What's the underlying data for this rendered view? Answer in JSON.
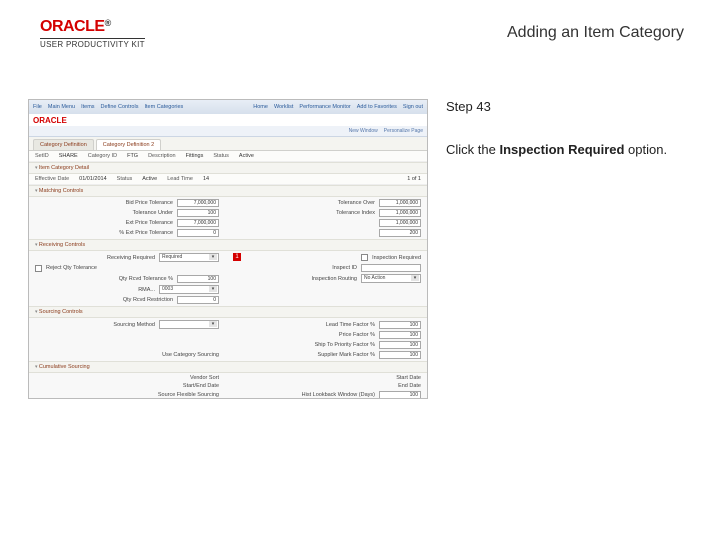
{
  "header": {
    "product_upper": "ORACLE",
    "product_sub": "USER PRODUCTIVITY KIT",
    "title": "Adding an Item Category"
  },
  "instructions": {
    "step_label": "Step 43",
    "text_before": "Click the ",
    "text_bold": "Inspection Required",
    "text_after": " option."
  },
  "ss": {
    "topbar_left": [
      "File",
      "Main Menu",
      "Items",
      "Define Controls",
      "Item Categories"
    ],
    "topbar_right": [
      "Home",
      "Worklist",
      "Performance Monitor",
      "Add to Favorites",
      "Sign out"
    ],
    "oracle_logo": "ORACLE",
    "subbar": [
      "New Window",
      "Personalize Page"
    ],
    "tabs": [
      "Category Definition",
      "Category Definition 2"
    ],
    "row1": {
      "col1_lbl": "SetID",
      "col1_val": "SHARE",
      "col2_lbl": "Category ID",
      "col2_val": "FTG",
      "col3_lbl": "Description",
      "col3_val": "Fittings",
      "col4_lbl": "Status",
      "col4_val": "Active"
    },
    "row2_title": "Item Category Detail",
    "row2": {
      "col1_lbl": "Effective Date",
      "col1_val": "01/01/2014",
      "col2_lbl": "Status",
      "col2_val": "Active",
      "col3_lbl": "Lead Time",
      "col3_val": "14",
      "col4_lbl": "1 of 1"
    },
    "sec_pricing": "Matching Controls",
    "pricing": [
      {
        "l": "Bid Price Tolerance",
        "v": "7,000,000",
        "r": "Tolerance Over",
        "rv": "1,000,000"
      },
      {
        "l": "Tolerance Under",
        "v": "100",
        "r": "Tolerance Index",
        "rv": "1,000,000"
      },
      {
        "l": "Ext Price Tolerance",
        "v": "7,000,000",
        "r": "",
        "rv": "1,000,000"
      },
      {
        "l": "% Ext Price Tolerance",
        "v": "0",
        "r": "",
        "rv": "200"
      }
    ],
    "sec_receiving": "Receiving Controls",
    "receiving": {
      "routing": {
        "l": "Receiving Required",
        "v": "Required"
      },
      "reject": {
        "l": "Reject Qty Tolerance",
        "v": ""
      },
      "qty_pct": {
        "l": "Qty Rcvd Tolerance %",
        "v": "100"
      },
      "rma_lbl": "RMA...",
      "rma_val": "0003",
      "inspection_lbl": "Inspection Required",
      "insp_id_lbl": "Inspect ID",
      "insp_routing_lbl": "Inspection Routing",
      "insp_routing_val": "No Action",
      "early": {
        "l": "Qty Rcvd Restriction",
        "v": "0"
      }
    },
    "sec_sourcing": "Sourcing Controls",
    "sourcing": [
      {
        "l": "Sourcing Method",
        "v": "",
        "r": "Lead Time Factor %",
        "rv": "100"
      },
      {
        "l": "",
        "v": "",
        "r": "Price Factor %",
        "rv": "100"
      },
      {
        "l": "",
        "v": "",
        "r": "Ship To Priority Factor %",
        "rv": "100"
      },
      {
        "l": "Use Category Sourcing",
        "v": "",
        "r": "Supplier Mark Factor %",
        "rv": "100"
      }
    ],
    "sec_cumulative": "Cumulative Sourcing",
    "cum": [
      {
        "l": "Vendor Sort",
        "v": "",
        "r": "Start Date",
        "rv": ""
      },
      {
        "l": "Start/End Date",
        "v": "",
        "r": "End Date",
        "rv": ""
      },
      {
        "l": "Source Flexible Sourcing",
        "v": "",
        "r": "Hist Lookback Window (Days)",
        "rv": "100"
      }
    ],
    "callout_marker": "1"
  }
}
